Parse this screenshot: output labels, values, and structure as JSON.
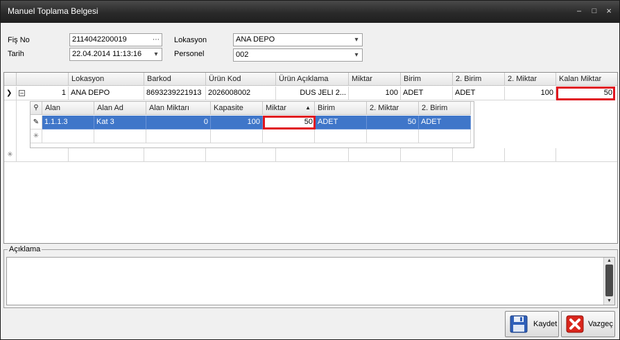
{
  "window": {
    "title": "Manuel Toplama Belgesi"
  },
  "form": {
    "fis_no_label": "Fiş No",
    "fis_no_value": "2114042200019",
    "tarih_label": "Tarih",
    "tarih_value": "22.04.2014 11:13:16",
    "lokasyon_label": "Lokasyon",
    "lokasyon_value": "ANA DEPO",
    "personel_label": "Personel",
    "personel_value": "002"
  },
  "grid": {
    "columns": [
      "Lokasyon",
      "Barkod",
      "Ürün Kod",
      "Ürün Açıklama",
      "Miktar",
      "Birim",
      "2. Birim",
      "2. Miktar",
      "Kalan Miktar"
    ],
    "row": {
      "index": "1",
      "lokasyon": "ANA DEPO",
      "barkod": "8693239221913",
      "urun_kod": "2026008002",
      "urun_aciklama": "DUS JELI 2...",
      "miktar": "100",
      "birim": "ADET",
      "birim2": "ADET",
      "miktar2": "100",
      "kalan_miktar": "50"
    },
    "detail": {
      "columns": [
        "Alan",
        "Alan Ad",
        "Alan Miktarı",
        "Kapasite",
        "Miktar",
        "Birim",
        "2. Miktar",
        "2. Birim"
      ],
      "row": {
        "alan": "1.1.1.3",
        "alan_ad": "Kat 3",
        "alan_miktari": "0",
        "kapasite": "100",
        "miktar": "50",
        "birim": "ADET",
        "miktar2": "50",
        "birim2": "ADET"
      }
    }
  },
  "aciklama": {
    "label": "Açıklama"
  },
  "buttons": {
    "save": "Kaydet",
    "cancel": "Vazgeç"
  },
  "colors": {
    "selection": "#3f76c9",
    "highlight": "#e0141e",
    "titlebar": "#2a2a2a"
  }
}
